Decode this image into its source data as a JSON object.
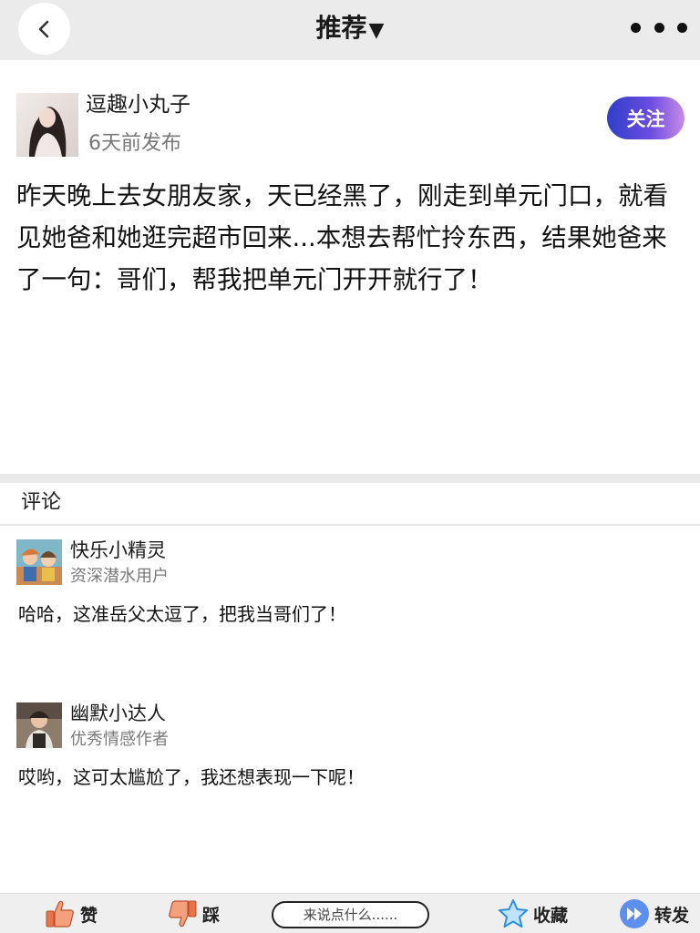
{
  "header": {
    "title": "推荐",
    "dropdown_caret": "▼",
    "back_icon": "chevron-left-icon",
    "more_icon": "more-dots-icon"
  },
  "post": {
    "author": "逗趣小丸子",
    "time": "6天前发布",
    "follow_label": "关注",
    "body": "昨天晚上去女朋友家，天已经黑了，刚走到单元门口，就看见她爸和她逛完超市回来...本想去帮忙拎东西，结果她爸来了一句：哥们，帮我把单元门开开就行了！"
  },
  "comments_section": {
    "title": "评论",
    "items": [
      {
        "name": "快乐小精灵",
        "role": "资深潜水用户",
        "text": "哈哈，这准岳父太逗了，把我当哥们了！"
      },
      {
        "name": "幽默小达人",
        "role": "优秀情感作者",
        "text": "哎哟，这可太尴尬了，我还想表现一下呢！"
      }
    ]
  },
  "bottom_bar": {
    "like_label": "赞",
    "dislike_label": "踩",
    "comment_placeholder": "来说点什么......",
    "favorite_label": "收藏",
    "share_label": "转发"
  },
  "colors": {
    "follow_gradient_start": "#2f3fc9",
    "follow_gradient_end": "#c88be6",
    "like_icon": "#e8734a",
    "star_icon": "#2a8fe0",
    "share_icon": "#3b7de8"
  }
}
